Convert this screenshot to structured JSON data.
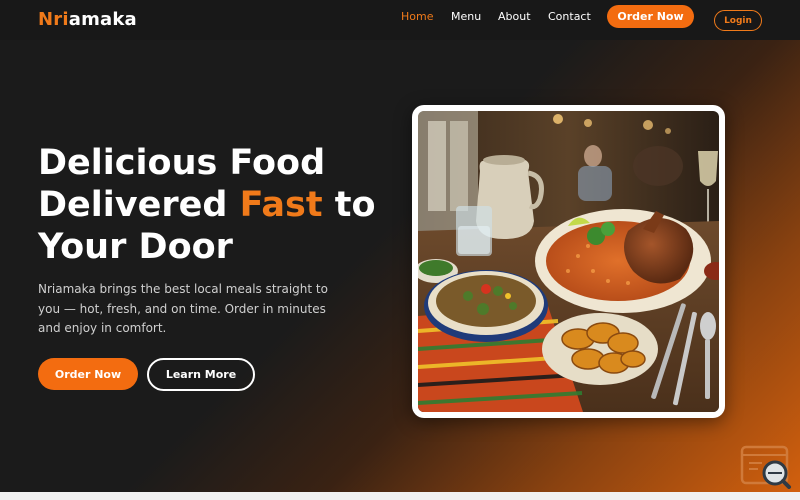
{
  "brand": {
    "accent": "Nri",
    "rest": "amaka",
    "accent_color": "#f07a1a"
  },
  "nav": {
    "links": [
      {
        "label": "Home",
        "active": true
      },
      {
        "label": "Menu",
        "active": false
      },
      {
        "label": "About",
        "active": false
      },
      {
        "label": "Contact",
        "active": false
      }
    ],
    "order_label": "Order Now",
    "login_label": "Login"
  },
  "hero": {
    "headline_part1": "Delicious Food Delivered ",
    "headline_highlight": "Fast",
    "headline_part2": " to Your Door",
    "description": "Nriamaka brings the best local meals straight to you — hot, fresh, and on time. Order in minutes and enjoy in comfort.",
    "primary_button": "Order Now",
    "secondary_button": "Learn More"
  },
  "colors": {
    "background": "#1b1b1b",
    "primary": "#f36c10",
    "text": "#ffffff"
  }
}
